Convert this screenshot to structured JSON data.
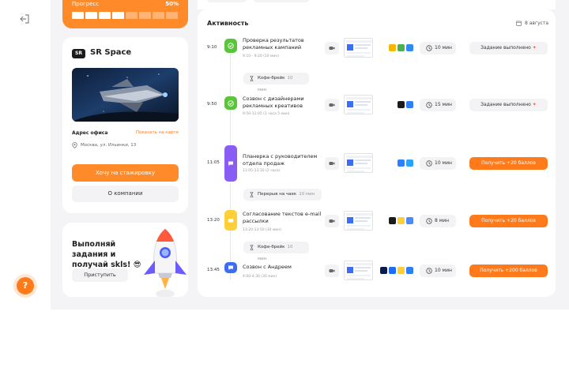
{
  "colors": {
    "accent": "#ff7a1a",
    "green": "#5ac43a",
    "purple": "#8a5cf6",
    "yellow": "#ffcf3a",
    "blue": "#3b6ef5"
  },
  "progress": {
    "label": "Прогресс",
    "percent_text": "50%",
    "segments_total": 8,
    "segments_on": 4
  },
  "company": {
    "logo_text": "SR",
    "name": "SR Space",
    "address_title": "Адрес офиса",
    "map_link": "Показать на карте",
    "address": "Москва, ул. Ильинки, 13",
    "intern_button": "Хочу на стажировку",
    "about_button": "О компании"
  },
  "promo": {
    "title": "Выполняй задания и получай skls! 😎",
    "button": "Приступить"
  },
  "help": "?",
  "activity": {
    "title": "Активность",
    "date": "8 августа",
    "items": [
      {
        "time": "9:10",
        "title": "Проверка результатов рекламных кампаний",
        "sub": "9:10 - 9:20 (10 мин)",
        "duration": "10 мин",
        "action": "Задание выполнено",
        "action_type": "done",
        "node_color": "#5ac43a",
        "icon": "check-icon"
      },
      {
        "time": "9:50",
        "title": "Созвон с дизайнерами рекламных креативов",
        "sub": "9:50-11:05 (1 часа 5 мин)",
        "duration": "15 мин",
        "action": "Задание выполнено",
        "action_type": "done",
        "node_color": "#5ac43a",
        "icon": "check-icon"
      },
      {
        "time": "11:05",
        "title": "Планерка с руководителем отдела продаж",
        "sub": "11:05-13:10 (2 часа)",
        "duration": "10 мин",
        "action": "Получить +20 баллов",
        "action_type": "points",
        "node_color": "#8a5cf6",
        "icon": "chat-icon"
      },
      {
        "time": "13:20",
        "title": "Согласование текстов e-mail рассылки",
        "sub": "13:20-13:50 (30 мин)",
        "duration": "8 мин",
        "action": "Получить +20 баллов",
        "action_type": "points",
        "node_color": "#ffcf3a",
        "icon": "mail-icon"
      },
      {
        "time": "13:45",
        "title": "Созвон с Андреем",
        "sub": "4:00-4:30 (30 мин)",
        "duration": "10 мин",
        "action": "Получить +200 баллов",
        "action_type": "points",
        "node_color": "#3b6ef5",
        "icon": "chat-icon"
      }
    ],
    "breaks": [
      {
        "label": "Кофе-брейк",
        "duration": "10 мин"
      },
      {
        "label": "Перерыв на чаек",
        "duration": "10 мин"
      },
      {
        "label": "Кофе-брейк",
        "duration": "10 мин"
      }
    ]
  }
}
